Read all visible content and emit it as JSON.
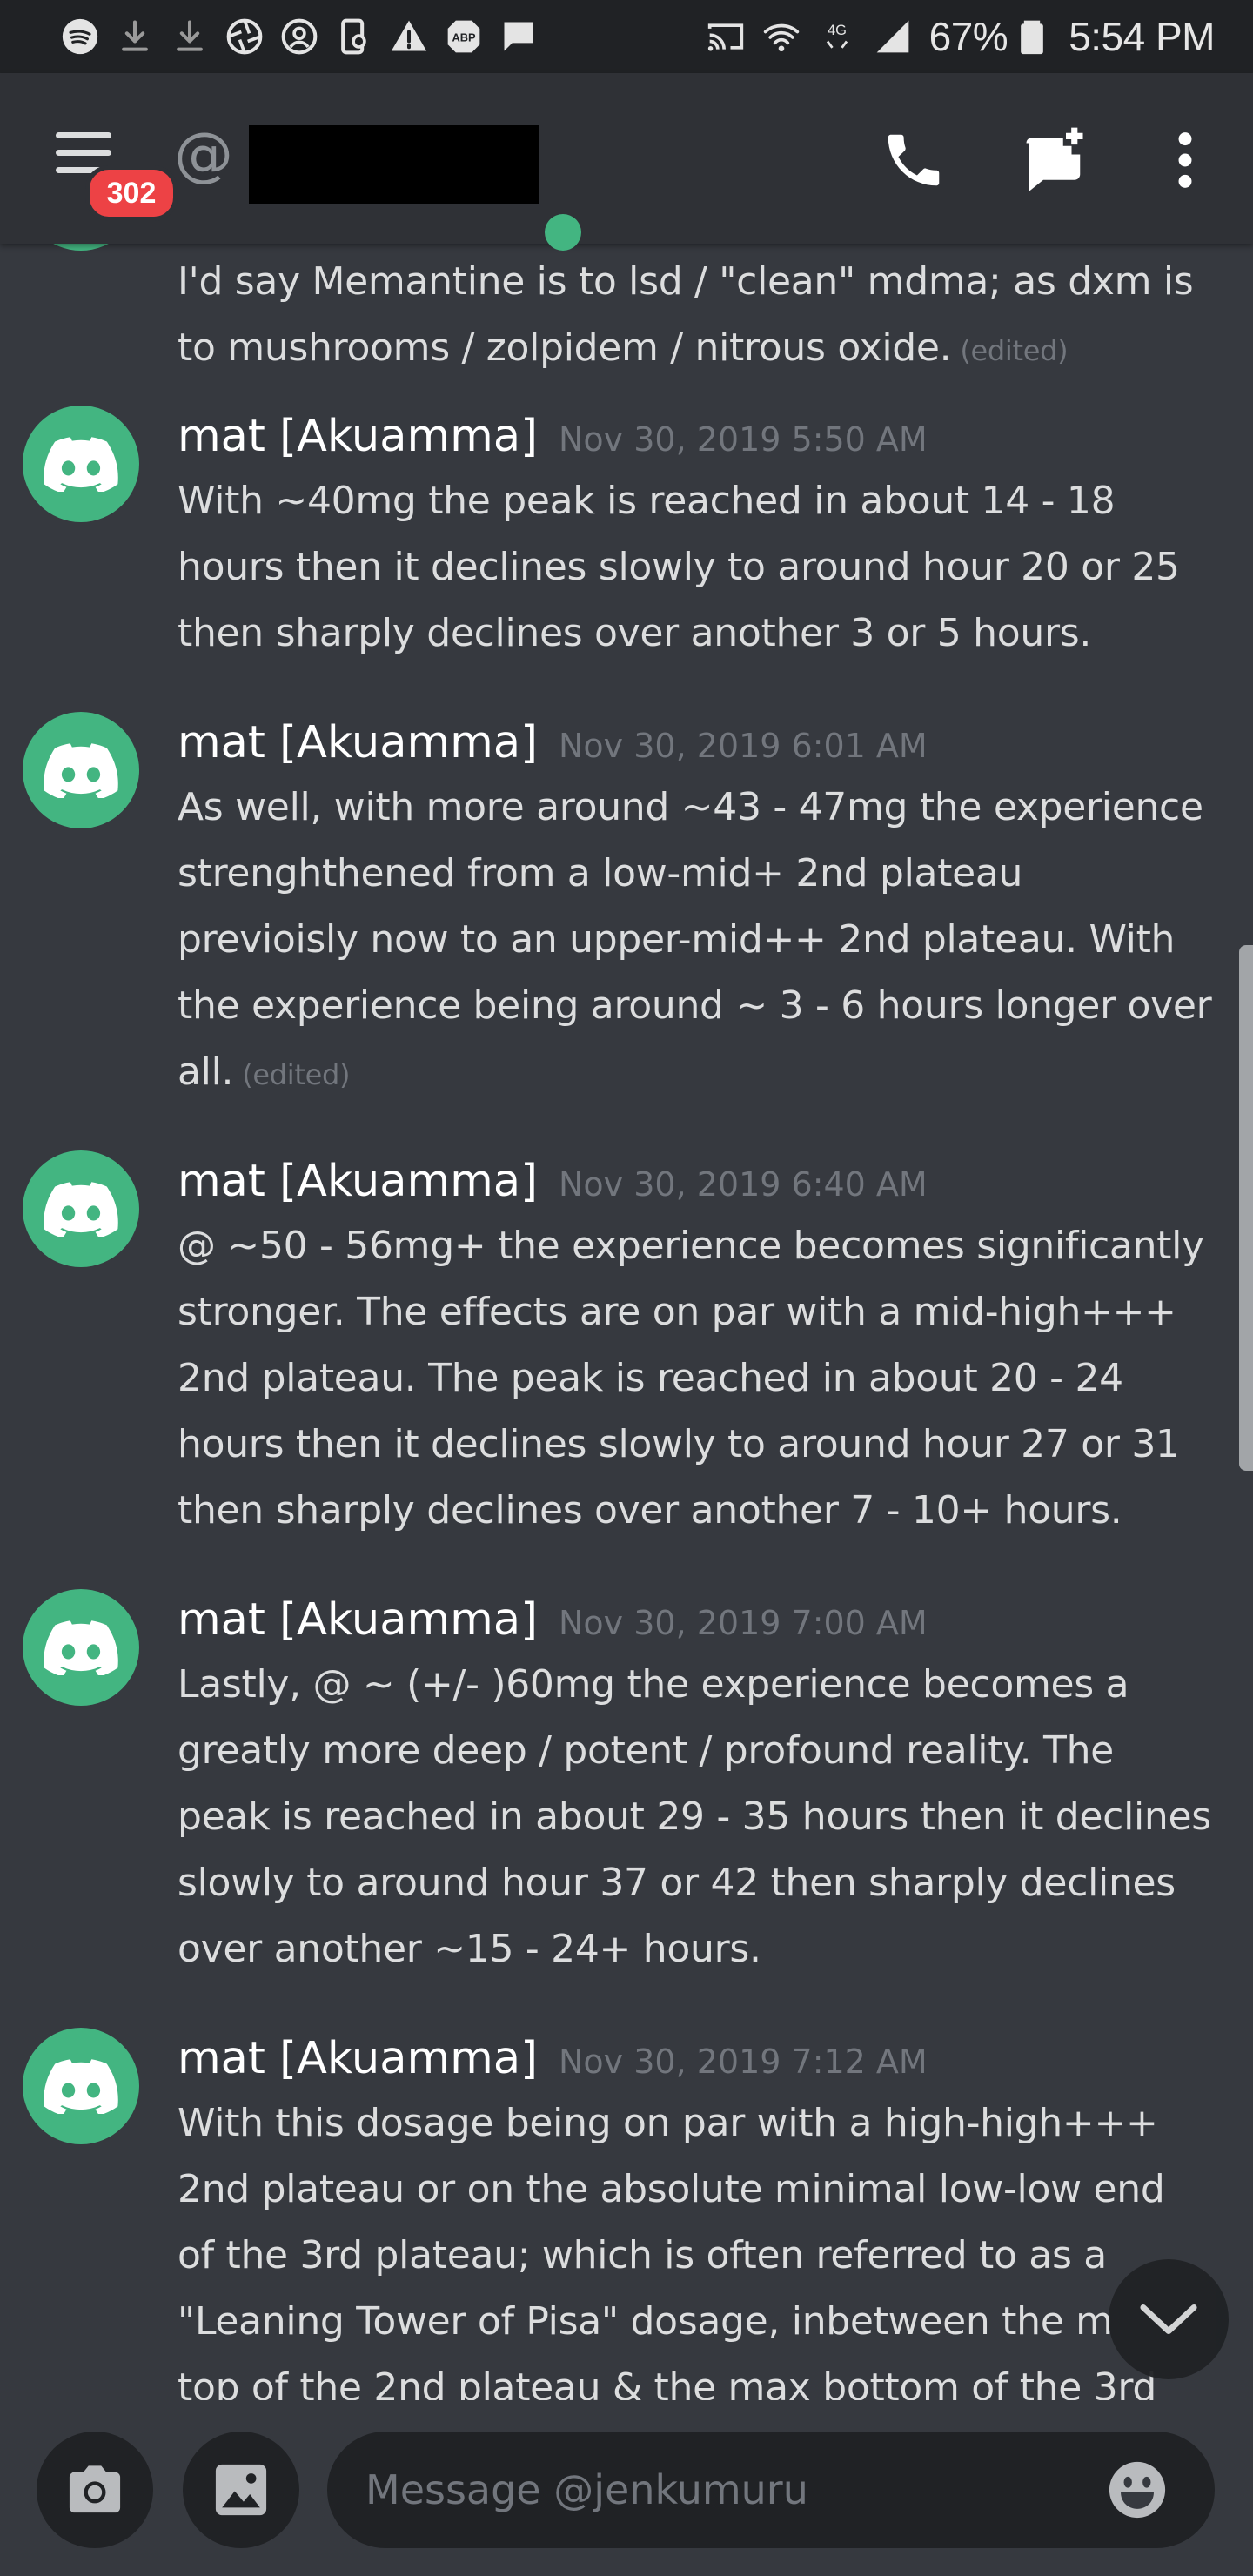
{
  "status_bar": {
    "left_icons": [
      "spotify-icon",
      "download-icon",
      "download-icon",
      "aperture-icon",
      "account-circle-icon",
      "phone-settings-icon",
      "warning-icon",
      "adblock-icon",
      "message-icon"
    ],
    "right_icons": [
      "cast-icon",
      "wifi-icon",
      "4g-icon",
      "signal-icon"
    ],
    "battery": "67%",
    "time": "5:54 PM"
  },
  "header": {
    "unread_badge": "302",
    "channel_prefix": "@",
    "status_color": "#43b581",
    "actions": [
      "phone-icon",
      "new-group-dm-icon",
      "more-icon"
    ]
  },
  "messages": [
    {
      "author": "",
      "timestamp": "",
      "lines": [
        "I'd say Memantine is to lsd / \"clean\" mdma; as dxm is",
        "to mushrooms / zolpidem / nitrous oxide."
      ],
      "edited": "(edited)"
    },
    {
      "author": "mat [Akuamma]",
      "timestamp": "Nov 30, 2019 5:50 AM",
      "lines": [
        "With ~40mg the peak is reached in about 14 - 18",
        "hours then it declines slowly to around hour 20 or 25",
        "then sharply declines over another 3 or 5 hours."
      ],
      "edited": ""
    },
    {
      "author": "mat [Akuamma]",
      "timestamp": "Nov 30, 2019 6:01 AM",
      "lines": [
        "As well, with more around ~43 - 47mg the experience",
        "strenghthened from a low-mid+ 2nd plateau",
        "previoisly now to an upper-mid++ 2nd plateau. With",
        "the experience being around ~ 3 - 6 hours longer over",
        "all."
      ],
      "edited": "(edited)"
    },
    {
      "author": "mat [Akuamma]",
      "timestamp": "Nov 30, 2019 6:40 AM",
      "lines": [
        "@ ~50 - 56mg+ the experience becomes significantly",
        "stronger. The effects are on par with a mid-high+++",
        "2nd plateau. The peak is reached in about 20 - 24",
        "hours then it declines slowly to around hour 27 or 31",
        "then sharply declines over another 7 - 10+ hours."
      ],
      "edited": ""
    },
    {
      "author": "mat [Akuamma]",
      "timestamp": "Nov 30, 2019 7:00 AM",
      "lines": [
        "Lastly, @ ~ (+/- )60mg the experience becomes a",
        "greatly more deep / potent / profound reality. The",
        "peak is reached in about 29 - 35 hours then it declines",
        "slowly to around hour 37 or 42 then sharply declines",
        "over another ~15 - 24+ hours."
      ],
      "edited": ""
    },
    {
      "author": "mat [Akuamma]",
      "timestamp": "Nov 30, 2019 7:12 AM",
      "lines": [
        "With this dosage being on par with a high-high+++",
        "2nd plateau or on the absolute minimal low-low end",
        "of the 3rd plateau; which is often referred to as a",
        "\"Leaning Tower of Pisa\" dosage, inbetween the m",
        "top of the 2nd plateau & the max bottom of the 3rd"
      ],
      "edited": ""
    }
  ],
  "composer": {
    "placeholder": "Message @jenkumuru",
    "left_buttons": [
      "camera-icon",
      "image-icon"
    ],
    "right_button": "emoji-icon"
  },
  "colors": {
    "background": "#36393f",
    "header": "#2f3136",
    "input": "#202225",
    "accent_green": "#43b581",
    "badge_red": "#ed4245",
    "muted_text": "#72767d"
  }
}
